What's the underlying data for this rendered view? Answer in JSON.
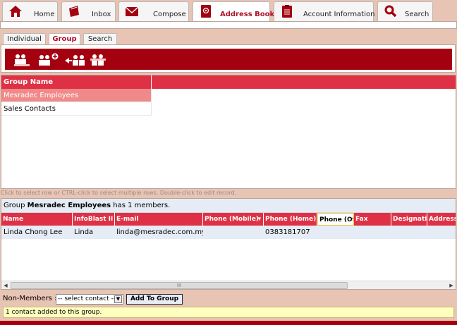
{
  "nav": {
    "tabs": [
      {
        "label": "Home",
        "icon": "home-icon"
      },
      {
        "label": "Inbox",
        "icon": "folder-icon"
      },
      {
        "label": "Compose",
        "icon": "envelope-icon"
      },
      {
        "label": "Address Book",
        "icon": "address-book-icon",
        "active": true
      },
      {
        "label": "Account Information",
        "icon": "clipboard-icon"
      },
      {
        "label": "Search",
        "icon": "magnifier-icon"
      }
    ]
  },
  "subtabs": [
    {
      "label": "Individual"
    },
    {
      "label": "Group",
      "active": true
    },
    {
      "label": "Search"
    }
  ],
  "toolbar": {
    "icons": [
      "group-icon",
      "add-group-icon",
      "move-group-icon",
      "delete-group-icon"
    ]
  },
  "groups": {
    "header": "Group Name",
    "rows": [
      {
        "name": "Mesradec Employees",
        "selected": true
      },
      {
        "name": "Sales Contacts",
        "selected": false
      }
    ]
  },
  "hint": "Click to select row or CTRL-click to select multiple rows. Double-click to edit record.",
  "members": {
    "info_prefix": "Group ",
    "group_name": "Mesradec Employees",
    "info_suffix": " has 1 members.",
    "columns": [
      "Name",
      "InfoBlast II",
      "E-mail",
      "Phone (Mobile)",
      "Phone (Home)",
      "Phone (Of",
      "Fax",
      "Designatio",
      "Address"
    ],
    "rows": [
      {
        "name": "Linda Chong Lee",
        "infoblast": "Linda",
        "email": "linda@mesradec.com.my",
        "mobile": "",
        "home": "0383181707",
        "office": "",
        "fax": "",
        "designation": "",
        "address": ""
      }
    ],
    "scroll_grip": "III"
  },
  "nonmembers": {
    "label": "Non-Members :",
    "select_value": "-- select contact --",
    "button_label": "Add To Group"
  },
  "status": "1 contact added to this group.",
  "colors": {
    "accent": "#de3146",
    "dark_red": "#a30010",
    "background": "#e8c4b4"
  }
}
